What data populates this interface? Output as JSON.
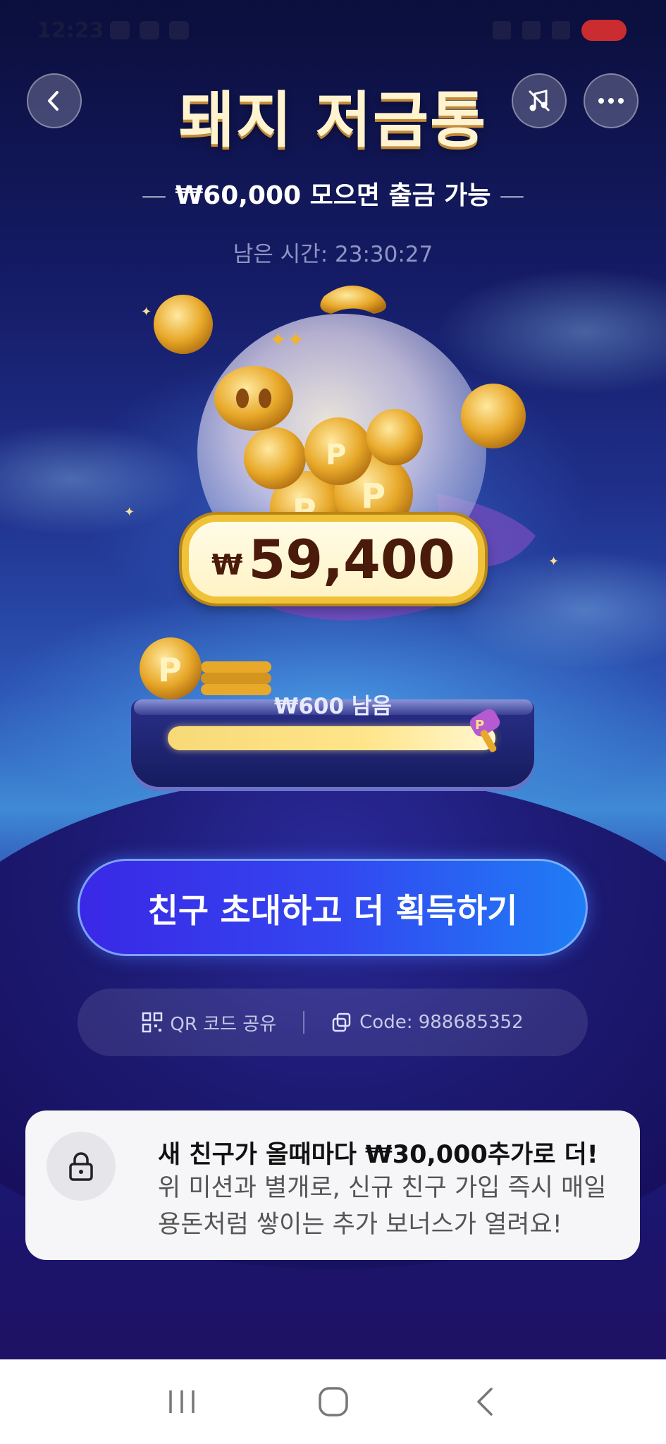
{
  "status_bar": {
    "time": "12:23"
  },
  "header": {
    "title": "돼지 저금통",
    "subtitle": "₩60,000 모으면 출금 가능",
    "timer": "남은 시간: 23:30:27"
  },
  "piggy": {
    "amount_currency": "₩",
    "amount_value": "59,400",
    "remaining": "₩600 남음",
    "progress_fraction": 0.99
  },
  "actions": {
    "invite_button": "친구 초대하고 더 획득하기",
    "qr_share": "QR 코드 공유",
    "code": "Code: 988685352"
  },
  "bonus": {
    "title": "새 친구가 올때마다 ₩30,000추가로 더!",
    "description": "위 미션과 별개로, 신규 친구 가입 즉시 매일 용돈처럼 쌓이는 추가 보너스가 열려요!"
  },
  "colors": {
    "accent_gold": "#f0c237",
    "cta_blue": "#3346f0",
    "battery_red": "#e0302e"
  },
  "icons": [
    "back-icon",
    "music-off-icon",
    "more-icon",
    "qr-icon",
    "copy-icon",
    "lock-icon",
    "recents-icon",
    "home-icon",
    "nav-back-icon",
    "hammer-icon",
    "coin-icon"
  ]
}
